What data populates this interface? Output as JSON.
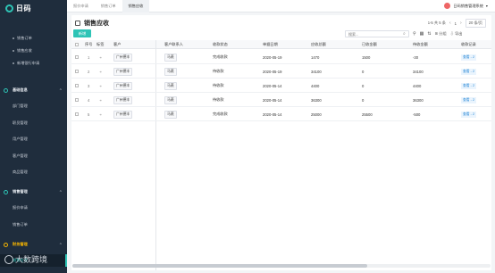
{
  "brand": {
    "name": "日码"
  },
  "sidebar": {
    "items": [
      {
        "label": "销售订单",
        "type": "sub"
      },
      {
        "label": "销售应收",
        "type": "sub"
      },
      {
        "label": "新增银行申请",
        "type": "sub"
      },
      {
        "label": "基础信息",
        "type": "group"
      },
      {
        "label": "部门管理",
        "type": "leaf"
      },
      {
        "label": "职员管理",
        "type": "leaf"
      },
      {
        "label": "用户管理",
        "type": "leaf"
      },
      {
        "label": "客户管理",
        "type": "leaf"
      },
      {
        "label": "商品管理",
        "type": "leaf"
      },
      {
        "label": "销售管理",
        "type": "group"
      },
      {
        "label": "报价申请",
        "type": "leaf"
      },
      {
        "label": "销售订单",
        "type": "leaf"
      },
      {
        "label": "财务管理",
        "type": "group",
        "active": true
      },
      {
        "label": "销售应收",
        "type": "leaf",
        "active": true
      }
    ]
  },
  "topbar": {
    "tabs": [
      "报价申请",
      "销售订单",
      "销售应收"
    ],
    "active_tab": 2,
    "user": "日码销售管理系统"
  },
  "page": {
    "title": "销售应收",
    "pager": {
      "range": "1-5 共 5 条",
      "page": "1",
      "page_size": "20 条/页"
    },
    "add_label": "新增",
    "search_placeholder": "搜索...",
    "tools": {
      "group_label": "分组",
      "export_label": "导出"
    }
  },
  "table": {
    "columns": [
      "序号",
      "标签",
      "客户",
      "客户联系人",
      "收款状态",
      "单据日期",
      "应收总额",
      "已收金额",
      "待收金额",
      "收款记录"
    ],
    "rows": [
      {
        "no": "1",
        "customer": "广州德丰",
        "contact": "马燕",
        "status": "完成收款",
        "date": "2020-05-19",
        "total": "1470",
        "received": "1500",
        "pending": "-30",
        "action": "查看 - 2"
      },
      {
        "no": "2",
        "customer": "广州德丰",
        "contact": "马燕",
        "status": "待收款",
        "date": "2020-05-19",
        "total": "34100",
        "received": "0",
        "pending": "34100",
        "action": "查看 - 2"
      },
      {
        "no": "3",
        "customer": "广州德丰",
        "contact": "马燕",
        "status": "待收款",
        "date": "2020-05-14",
        "total": "4400",
        "received": "0",
        "pending": "4400",
        "action": "查看 - 2"
      },
      {
        "no": "4",
        "customer": "广州德丰",
        "contact": "马燕",
        "status": "待收款",
        "date": "2020-05-14",
        "total": "36300",
        "received": "0",
        "pending": "36300",
        "action": "查看 - 2"
      },
      {
        "no": "5",
        "customer": "广州德丰",
        "contact": "马燕",
        "status": "完成收款",
        "date": "2020-05-14",
        "total": "25000",
        "received": "25500",
        "pending": "-500",
        "action": "查看 - 2"
      }
    ]
  },
  "watermark": {
    "text": "大数跨境"
  },
  "colors": {
    "accent": "#2ec4b6",
    "sidebar_bg": "#1f2d3d",
    "group_active": "#f5b400"
  }
}
